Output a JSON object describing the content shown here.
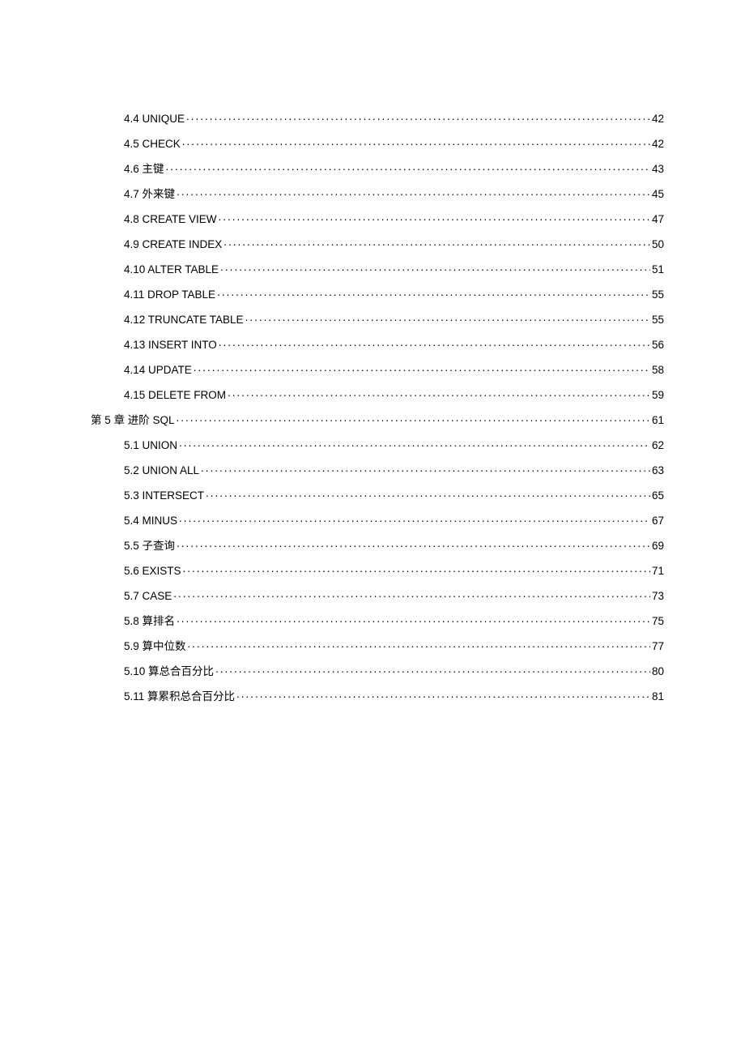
{
  "toc": [
    {
      "level": 2,
      "label": "4.4 UNIQUE",
      "page": "42"
    },
    {
      "level": 2,
      "label": "4.5 CHECK",
      "page": "42"
    },
    {
      "level": 2,
      "label": "4.6 主键",
      "page": "43"
    },
    {
      "level": 2,
      "label": "4.7 外来键",
      "page": "45"
    },
    {
      "level": 2,
      "label": "4.8 CREATE VIEW",
      "page": "47"
    },
    {
      "level": 2,
      "label": "4.9 CREATE INDEX",
      "page": "50"
    },
    {
      "level": 2,
      "label": "4.10 ALTER TABLE",
      "page": "51"
    },
    {
      "level": 2,
      "label": "4.11 DROP TABLE",
      "page": "55"
    },
    {
      "level": 2,
      "label": "4.12 TRUNCATE TABLE",
      "page": "55"
    },
    {
      "level": 2,
      "label": "4.13 INSERT INTO",
      "page": "56"
    },
    {
      "level": 2,
      "label": "4.14 UPDATE",
      "page": "58"
    },
    {
      "level": 2,
      "label": "4.15 DELETE FROM",
      "page": "59"
    },
    {
      "level": 1,
      "label": "第 5 章 进阶 SQL",
      "page": "61"
    },
    {
      "level": 2,
      "label": "5.1 UNION",
      "page": "62"
    },
    {
      "level": 2,
      "label": "5.2 UNION ALL",
      "page": "63"
    },
    {
      "level": 2,
      "label": "5.3 INTERSECT",
      "page": "65"
    },
    {
      "level": 2,
      "label": "5.4 MINUS",
      "page": "67"
    },
    {
      "level": 2,
      "label": "5.5 子查询",
      "page": "69"
    },
    {
      "level": 2,
      "label": "5.6 EXISTS",
      "page": "71"
    },
    {
      "level": 2,
      "label": "5.7 CASE",
      "page": "73"
    },
    {
      "level": 2,
      "label": "5.8 算排名",
      "page": "75"
    },
    {
      "level": 2,
      "label": "5.9 算中位数",
      "page": "77"
    },
    {
      "level": 2,
      "label": "5.10 算总合百分比",
      "page": "80"
    },
    {
      "level": 2,
      "label": "5.11 算累积总合百分比",
      "page": "81"
    }
  ]
}
